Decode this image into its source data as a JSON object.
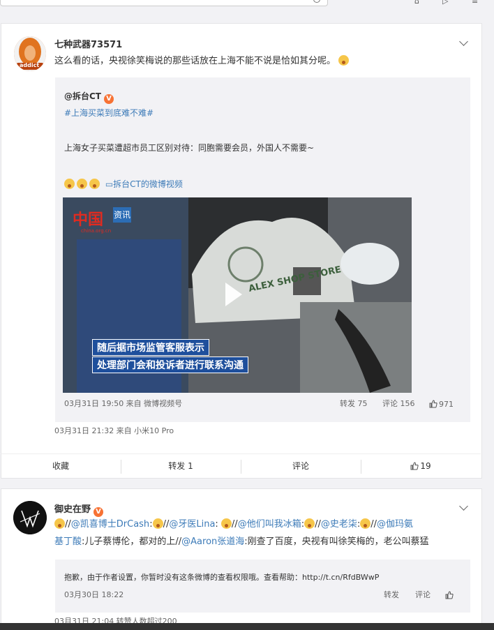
{
  "post1": {
    "username": "七种武器73571",
    "text": "这么看的话，央视徐笑梅说的那些话放在上海不能不说是恰如其分呢。",
    "avatar_text": "addict",
    "quote": {
      "username": "@拆台CT",
      "hashtag": "#上海买菜到底难不难#",
      "text": "上海女子买菜遭超市员工区别对待：同胞需要会员，外国人不需要~",
      "video_link": "拆台CT的微博视频",
      "video": {
        "logo": "中国",
        "logo_sub": "资讯",
        "site": "china.org.cn",
        "caption_line1": "随后据市场监管客服表示",
        "caption_line2": "处理部门会和投诉者进行联系沟通",
        "bag_text": "ALEX SHOP STORE"
      },
      "meta": "03月31日 19:50 来自 微博视频号",
      "repost": "转发 75",
      "comment": "评论 156",
      "like": "971"
    },
    "meta": "03月31日 21:32  来自 小米10 Pro",
    "actions": {
      "collect": "收藏",
      "repost": "转发 1",
      "comment": "评论",
      "like": "19"
    }
  },
  "post2": {
    "username": "御史在野",
    "badge": "V",
    "line1_parts": [
      "//",
      "@凯喜博士DrCash",
      ":",
      "//",
      "@牙医Lina",
      ": ",
      "//",
      "@他们叫我冰箱",
      ":",
      "//",
      "@史老柒",
      ":",
      "//",
      "@伽玛氨"
    ],
    "line2_parts": [
      "基丁酸",
      ":儿子蔡博伦，都对的上//",
      "@Aaron张道海",
      ":刚查了百度，央视有叫徐笑梅的，老公叫蔡猛"
    ],
    "quote": {
      "text": "抱歉，由于作者设置，你暂时没有这条微博的查看权限哦。查看帮助：http://t.cn/RfdBWwP",
      "meta": "03月30日 18:22",
      "repost": "转发",
      "comment": "评论"
    },
    "meta": "03月31日 21:04 转赞人数超过200"
  },
  "colors": {
    "link": "#3d7bb8",
    "badge": "#f77234",
    "caption_bg": "#1e4f9c"
  }
}
